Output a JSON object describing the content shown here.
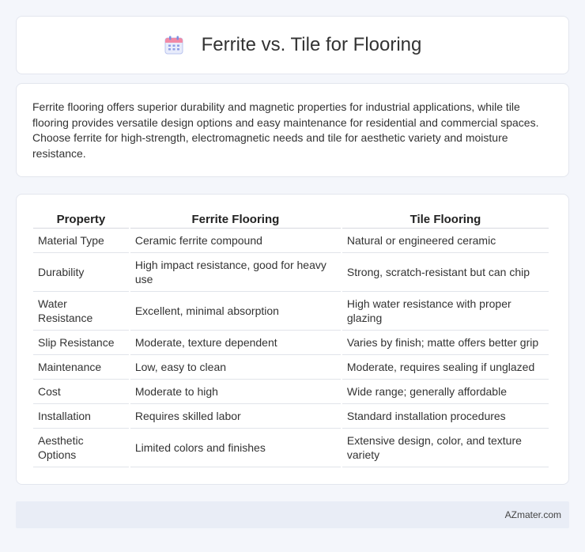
{
  "header": {
    "title": "Ferrite vs. Tile for Flooring",
    "icon": "calendar-icon"
  },
  "summary": {
    "text": "Ferrite flooring offers superior durability and magnetic properties for industrial applications, while tile flooring provides versatile design options and easy maintenance for residential and commercial spaces. Choose ferrite for high-strength, electromagnetic needs and tile for aesthetic variety and moisture resistance."
  },
  "table": {
    "headers": [
      "Property",
      "Ferrite Flooring",
      "Tile Flooring"
    ],
    "rows": [
      [
        "Material Type",
        "Ceramic ferrite compound",
        "Natural or engineered ceramic"
      ],
      [
        "Durability",
        "High impact resistance, good for heavy use",
        "Strong, scratch-resistant but can chip"
      ],
      [
        "Water Resistance",
        "Excellent, minimal absorption",
        "High water resistance with proper glazing"
      ],
      [
        "Slip Resistance",
        "Moderate, texture dependent",
        "Varies by finish; matte offers better grip"
      ],
      [
        "Maintenance",
        "Low, easy to clean",
        "Moderate, requires sealing if unglazed"
      ],
      [
        "Cost",
        "Moderate to high",
        "Wide range; generally affordable"
      ],
      [
        "Installation",
        "Requires skilled labor",
        "Standard installation procedures"
      ],
      [
        "Aesthetic Options",
        "Limited colors and finishes",
        "Extensive design, color, and texture variety"
      ]
    ]
  },
  "footer": {
    "text": "AZmater.com"
  },
  "colors": {
    "background": "#f4f6fb",
    "card": "#ffffff",
    "footer": "#e9edf6"
  }
}
